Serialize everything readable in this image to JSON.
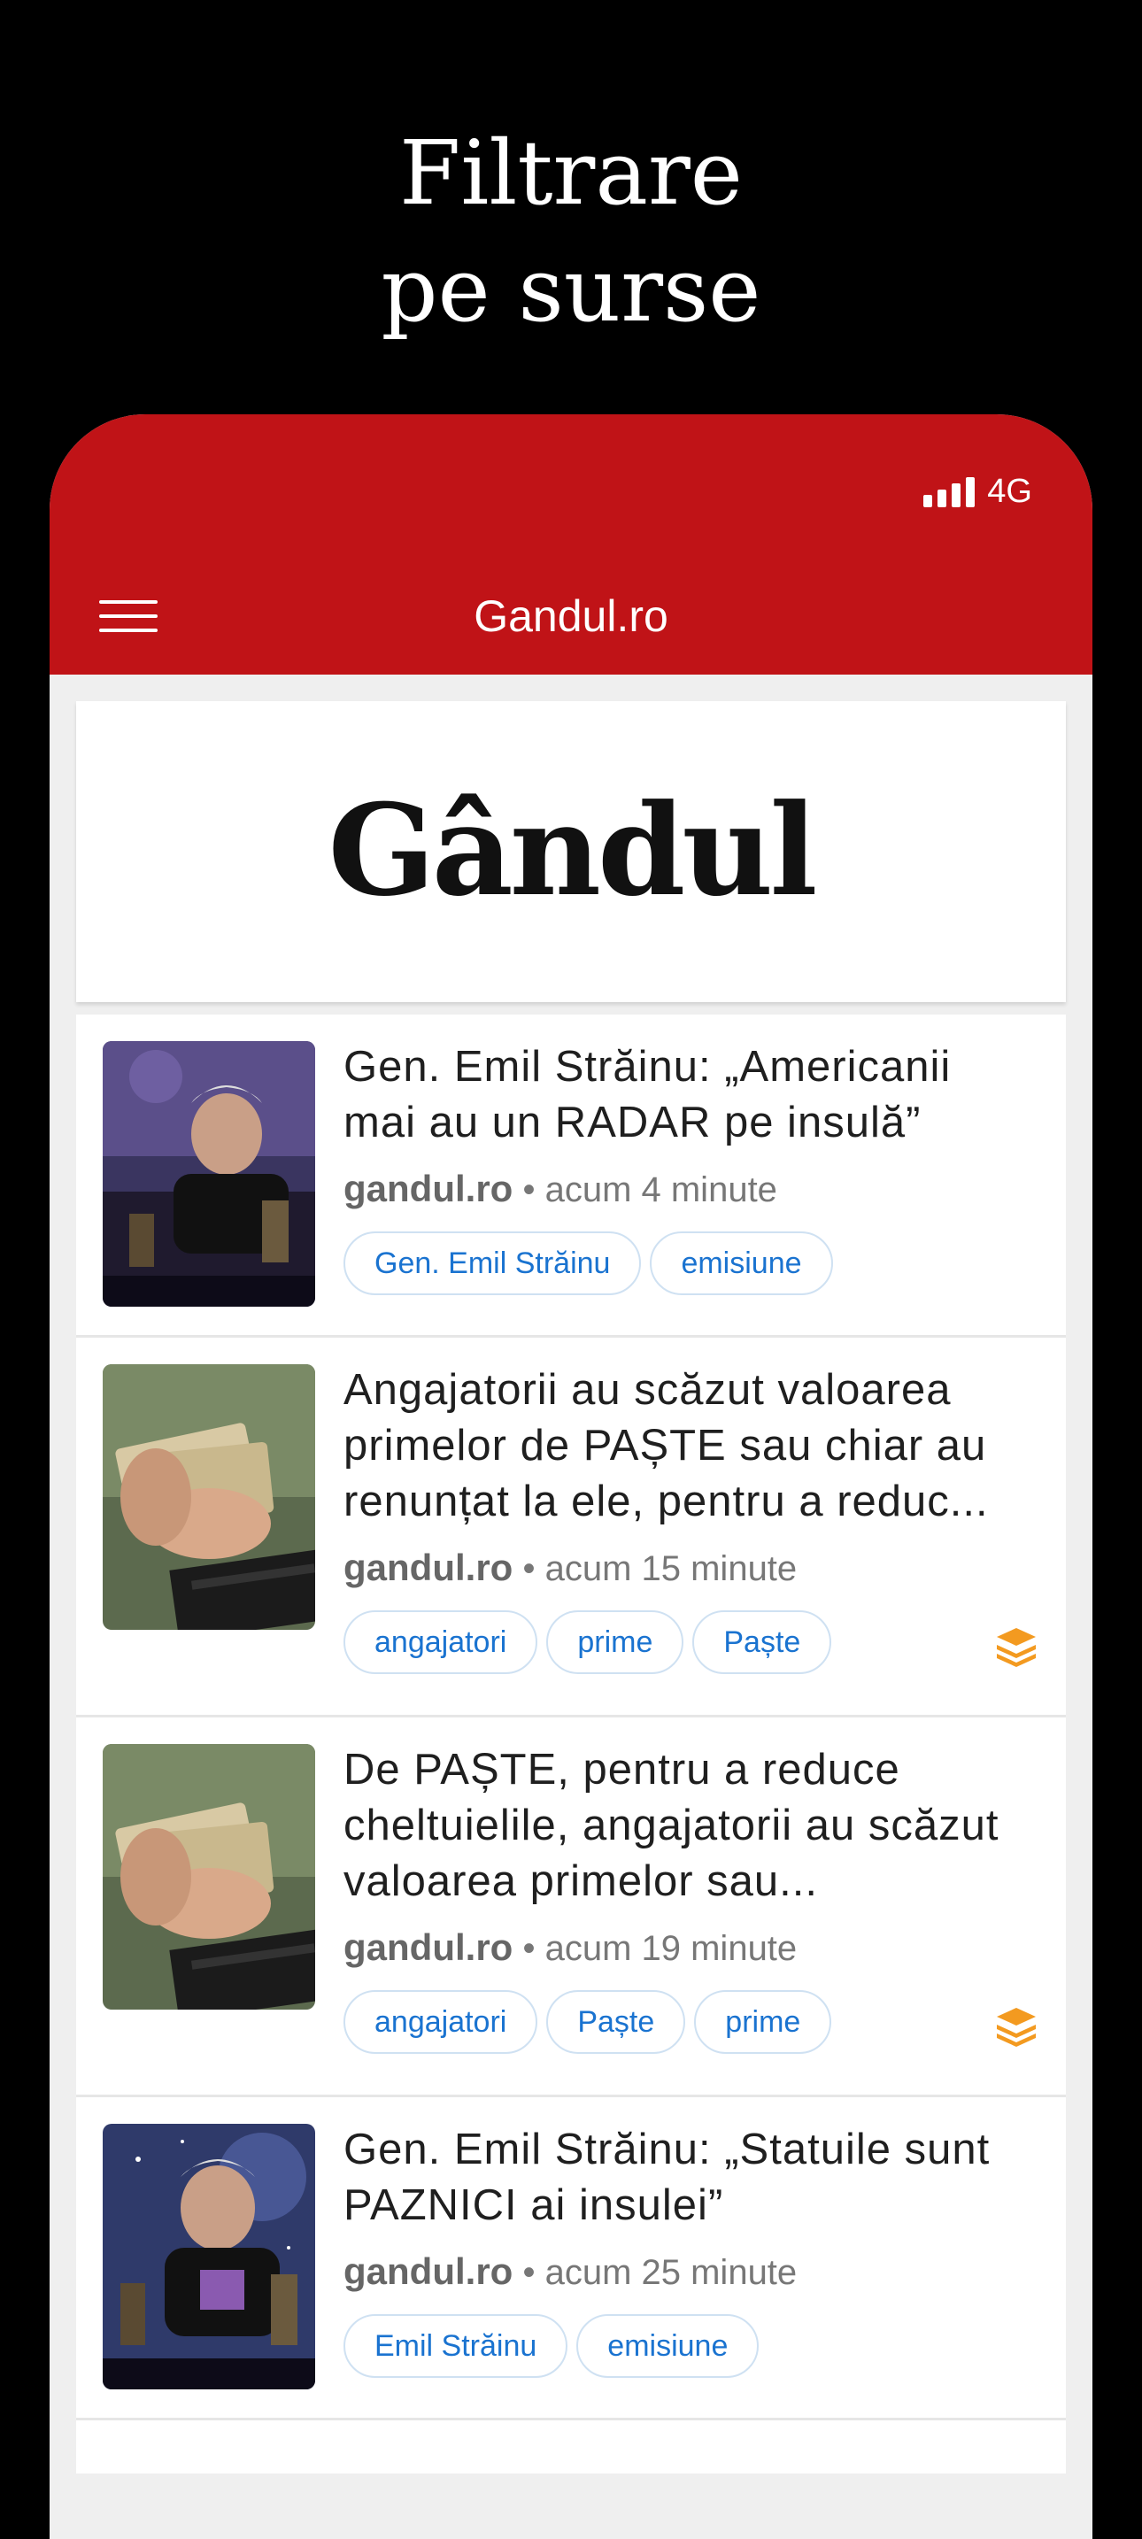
{
  "promo": {
    "line1": "Filtrare",
    "line2": "pe surse"
  },
  "status": {
    "network": "4G"
  },
  "appbar": {
    "title": "Gandul.ro"
  },
  "logo": {
    "text": "Gândul"
  },
  "colors": {
    "brand": "#c01317",
    "tag": "#1a73d0",
    "stack": "#f39a20"
  },
  "articles": [
    {
      "title": "Gen. Emil Străinu: „Americanii mai au un RADAR pe insulă”",
      "source": "gandul.ro",
      "time": "acum 4 minute",
      "tags": [
        "Gen. Emil Străinu",
        "emisiune"
      ],
      "stack_icon": false
    },
    {
      "title": "Angajatorii au scăzut valoarea primelor de PAȘTE sau chiar au renunțat la ele, pentru a reduc...",
      "source": "gandul.ro",
      "time": "acum 15 minute",
      "tags": [
        "angajatori",
        "prime",
        "Paște"
      ],
      "stack_icon": true
    },
    {
      "title": "De PAȘTE, pentru a reduce cheltuielile, angajatorii au scăzut valoarea primelor sau...",
      "source": "gandul.ro",
      "time": "acum 19 minute",
      "tags": [
        "angajatori",
        "Paște",
        "prime"
      ],
      "stack_icon": true
    },
    {
      "title": "Gen. Emil Străinu: „Statuile sunt PAZNICI ai insulei”",
      "source": "gandul.ro",
      "time": "acum 25 minute",
      "tags": [
        "Emil Străinu",
        "emisiune"
      ],
      "stack_icon": false
    }
  ]
}
